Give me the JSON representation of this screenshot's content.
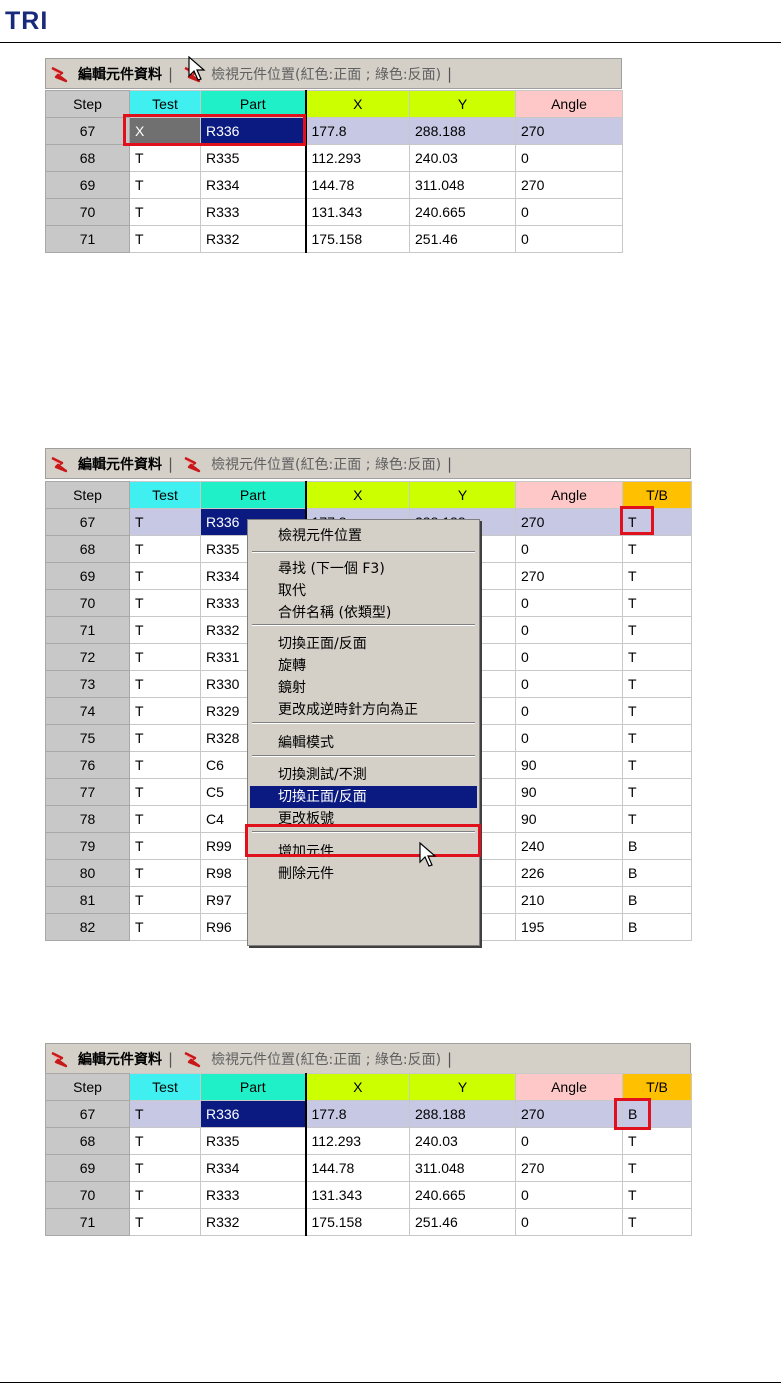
{
  "header": {
    "logo": "TRI"
  },
  "tabs": {
    "edit_label": "編輯元件資料",
    "view_label": "檢視元件位置(紅色:正面 ; 綠色:反面)",
    "separator": "|"
  },
  "colors": {
    "step_header": "#c8c8c8",
    "test_header": "#40f0f0",
    "part_header": "#20f0c8",
    "x_header": "#ccff00",
    "y_header": "#ccff00",
    "angle_header": "#ffc8c8",
    "tb_header": "#ffc000",
    "highlight_box": "#e0101c",
    "selection": "#0a1a80"
  },
  "table1": {
    "headers": {
      "step": "Step",
      "test": "Test",
      "part": "Part",
      "x": "X",
      "y": "Y",
      "angle": "Angle"
    },
    "rows": [
      {
        "step": "67",
        "test": "X",
        "part": "R336",
        "x": "177.8",
        "y": "288.188",
        "angle": "270"
      },
      {
        "step": "68",
        "test": "T",
        "part": "R335",
        "x": "112.293",
        "y": "240.03",
        "angle": "0"
      },
      {
        "step": "69",
        "test": "T",
        "part": "R334",
        "x": "144.78",
        "y": "311.048",
        "angle": "270"
      },
      {
        "step": "70",
        "test": "T",
        "part": "R333",
        "x": "131.343",
        "y": "240.665",
        "angle": "0"
      },
      {
        "step": "71",
        "test": "T",
        "part": "R332",
        "x": "175.158",
        "y": "251.46",
        "angle": "0"
      }
    ]
  },
  "table2": {
    "headers": {
      "step": "Step",
      "test": "Test",
      "part": "Part",
      "x": "X",
      "y": "Y",
      "angle": "Angle",
      "tb": "T/B"
    },
    "rows": [
      {
        "step": "67",
        "test": "T",
        "part": "R336",
        "x": "177.8",
        "y": "288.188",
        "angle": "270",
        "tb": "T"
      },
      {
        "step": "68",
        "test": "T",
        "part": "R335",
        "x": "",
        "y": "",
        "angle": "0",
        "tb": "T"
      },
      {
        "step": "69",
        "test": "T",
        "part": "R334",
        "x": "",
        "y": "",
        "angle": "270",
        "tb": "T"
      },
      {
        "step": "70",
        "test": "T",
        "part": "R333",
        "x": "",
        "y": "",
        "angle": "0",
        "tb": "T"
      },
      {
        "step": "71",
        "test": "T",
        "part": "R332",
        "x": "",
        "y": "",
        "angle": "0",
        "tb": "T"
      },
      {
        "step": "72",
        "test": "T",
        "part": "R331",
        "x": "",
        "y": "",
        "angle": "0",
        "tb": "T"
      },
      {
        "step": "73",
        "test": "T",
        "part": "R330",
        "x": "",
        "y": "",
        "angle": "0",
        "tb": "T"
      },
      {
        "step": "74",
        "test": "T",
        "part": "R329",
        "x": "",
        "y": "",
        "angle": "0",
        "tb": "T"
      },
      {
        "step": "75",
        "test": "T",
        "part": "R328",
        "x": "",
        "y": "",
        "angle": "0",
        "tb": "T"
      },
      {
        "step": "76",
        "test": "T",
        "part": "C6",
        "x": "",
        "y": "",
        "angle": "90",
        "tb": "T"
      },
      {
        "step": "77",
        "test": "T",
        "part": "C5",
        "x": "",
        "y": "",
        "angle": "90",
        "tb": "T"
      },
      {
        "step": "78",
        "test": "T",
        "part": "C4",
        "x": "",
        "y": "",
        "angle": "90",
        "tb": "T"
      },
      {
        "step": "79",
        "test": "T",
        "part": "R99",
        "x": "",
        "y": "",
        "angle": "240",
        "tb": "B"
      },
      {
        "step": "80",
        "test": "T",
        "part": "R98",
        "x": "",
        "y": "",
        "angle": "226",
        "tb": "B"
      },
      {
        "step": "81",
        "test": "T",
        "part": "R97",
        "x": "",
        "y": "",
        "angle": "210",
        "tb": "B"
      },
      {
        "step": "82",
        "test": "T",
        "part": "R96",
        "x": "",
        "y": "",
        "angle": "195",
        "tb": "B"
      }
    ]
  },
  "context_menu": {
    "items": [
      "檢視元件位置",
      "尋找 (下一個 F3)",
      "取代",
      "合併名稱 (依類型)",
      "切換正面/反面",
      "旋轉",
      "鏡射",
      "更改成逆時針方向為正",
      "編輯模式",
      "切換測試/不測",
      "切換正面/反面",
      "更改板號",
      "增加元件",
      "刪除元件"
    ],
    "highlighted_index": 10
  },
  "table3": {
    "headers": {
      "step": "Step",
      "test": "Test",
      "part": "Part",
      "x": "X",
      "y": "Y",
      "angle": "Angle",
      "tb": "T/B"
    },
    "rows": [
      {
        "step": "67",
        "test": "T",
        "part": "R336",
        "x": "177.8",
        "y": "288.188",
        "angle": "270",
        "tb": "B"
      },
      {
        "step": "68",
        "test": "T",
        "part": "R335",
        "x": "112.293",
        "y": "240.03",
        "angle": "0",
        "tb": "T"
      },
      {
        "step": "69",
        "test": "T",
        "part": "R334",
        "x": "144.78",
        "y": "311.048",
        "angle": "270",
        "tb": "T"
      },
      {
        "step": "70",
        "test": "T",
        "part": "R333",
        "x": "131.343",
        "y": "240.665",
        "angle": "0",
        "tb": "T"
      },
      {
        "step": "71",
        "test": "T",
        "part": "R332",
        "x": "175.158",
        "y": "251.46",
        "angle": "0",
        "tb": "T"
      }
    ]
  }
}
